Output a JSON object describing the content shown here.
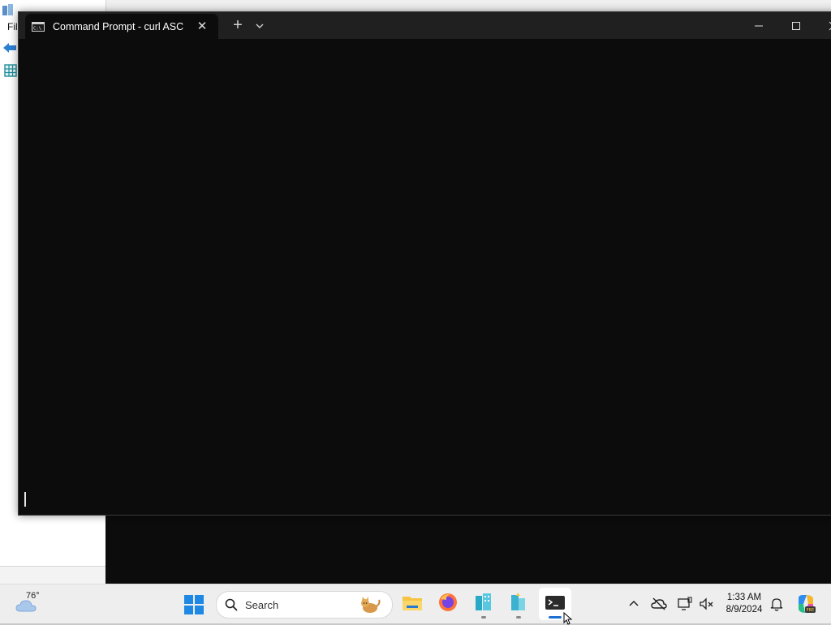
{
  "background_app": {
    "menu_file": "Fil"
  },
  "terminal": {
    "tab_title": "Command Prompt - curl  ASC",
    "tab_icon": "cmd-icon",
    "new_tab_label": "+",
    "close_tab_label": "✕"
  },
  "taskbar": {
    "weather_temp": "76°",
    "search_label": "Search",
    "apps": [
      {
        "name": "file-explorer-icon"
      },
      {
        "name": "firefox-icon"
      },
      {
        "name": "building-app-icon"
      },
      {
        "name": "building-app-2-icon"
      },
      {
        "name": "terminal-icon",
        "active": true
      }
    ],
    "clock_time": "1:33 AM",
    "clock_date": "8/9/2024"
  },
  "colors": {
    "terminal_bg": "#0c0c0c",
    "titlebar_bg": "#202020",
    "taskbar_bg": "#eeeeee",
    "accent": "#1f6fd0"
  }
}
